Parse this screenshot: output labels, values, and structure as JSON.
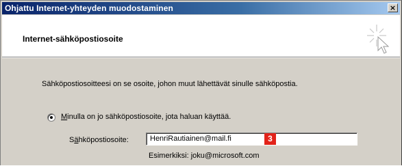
{
  "window": {
    "title": "Ohjattu Internet-yhteyden muodostaminen",
    "close_label": "×"
  },
  "header": {
    "title": "Internet-sähköpostiosoite",
    "icon": "wizard-sparkle-cursor-icon"
  },
  "main": {
    "intro_text": "Sähköpostiosoitteesi on se osoite, johon muut lähettävät sinulle sähköpostia.",
    "radio": {
      "selected": true,
      "label_accel": "M",
      "label_rest": "inulla on jo sähköpostiosoite, jota haluan käyttää."
    },
    "email_field": {
      "label_pre": "S",
      "label_accel": "ä",
      "label_post": "hköpostiosoite:",
      "value": "HenriRautiainen@mail.fi"
    },
    "example_text": "Esimerkiksi: joku@microsoft.com",
    "step_badge": "3"
  },
  "colors": {
    "titlebar_start": "#0a246a",
    "titlebar_end": "#a6caf0",
    "dialog_face": "#d4d0c8",
    "badge": "#e2231a"
  }
}
